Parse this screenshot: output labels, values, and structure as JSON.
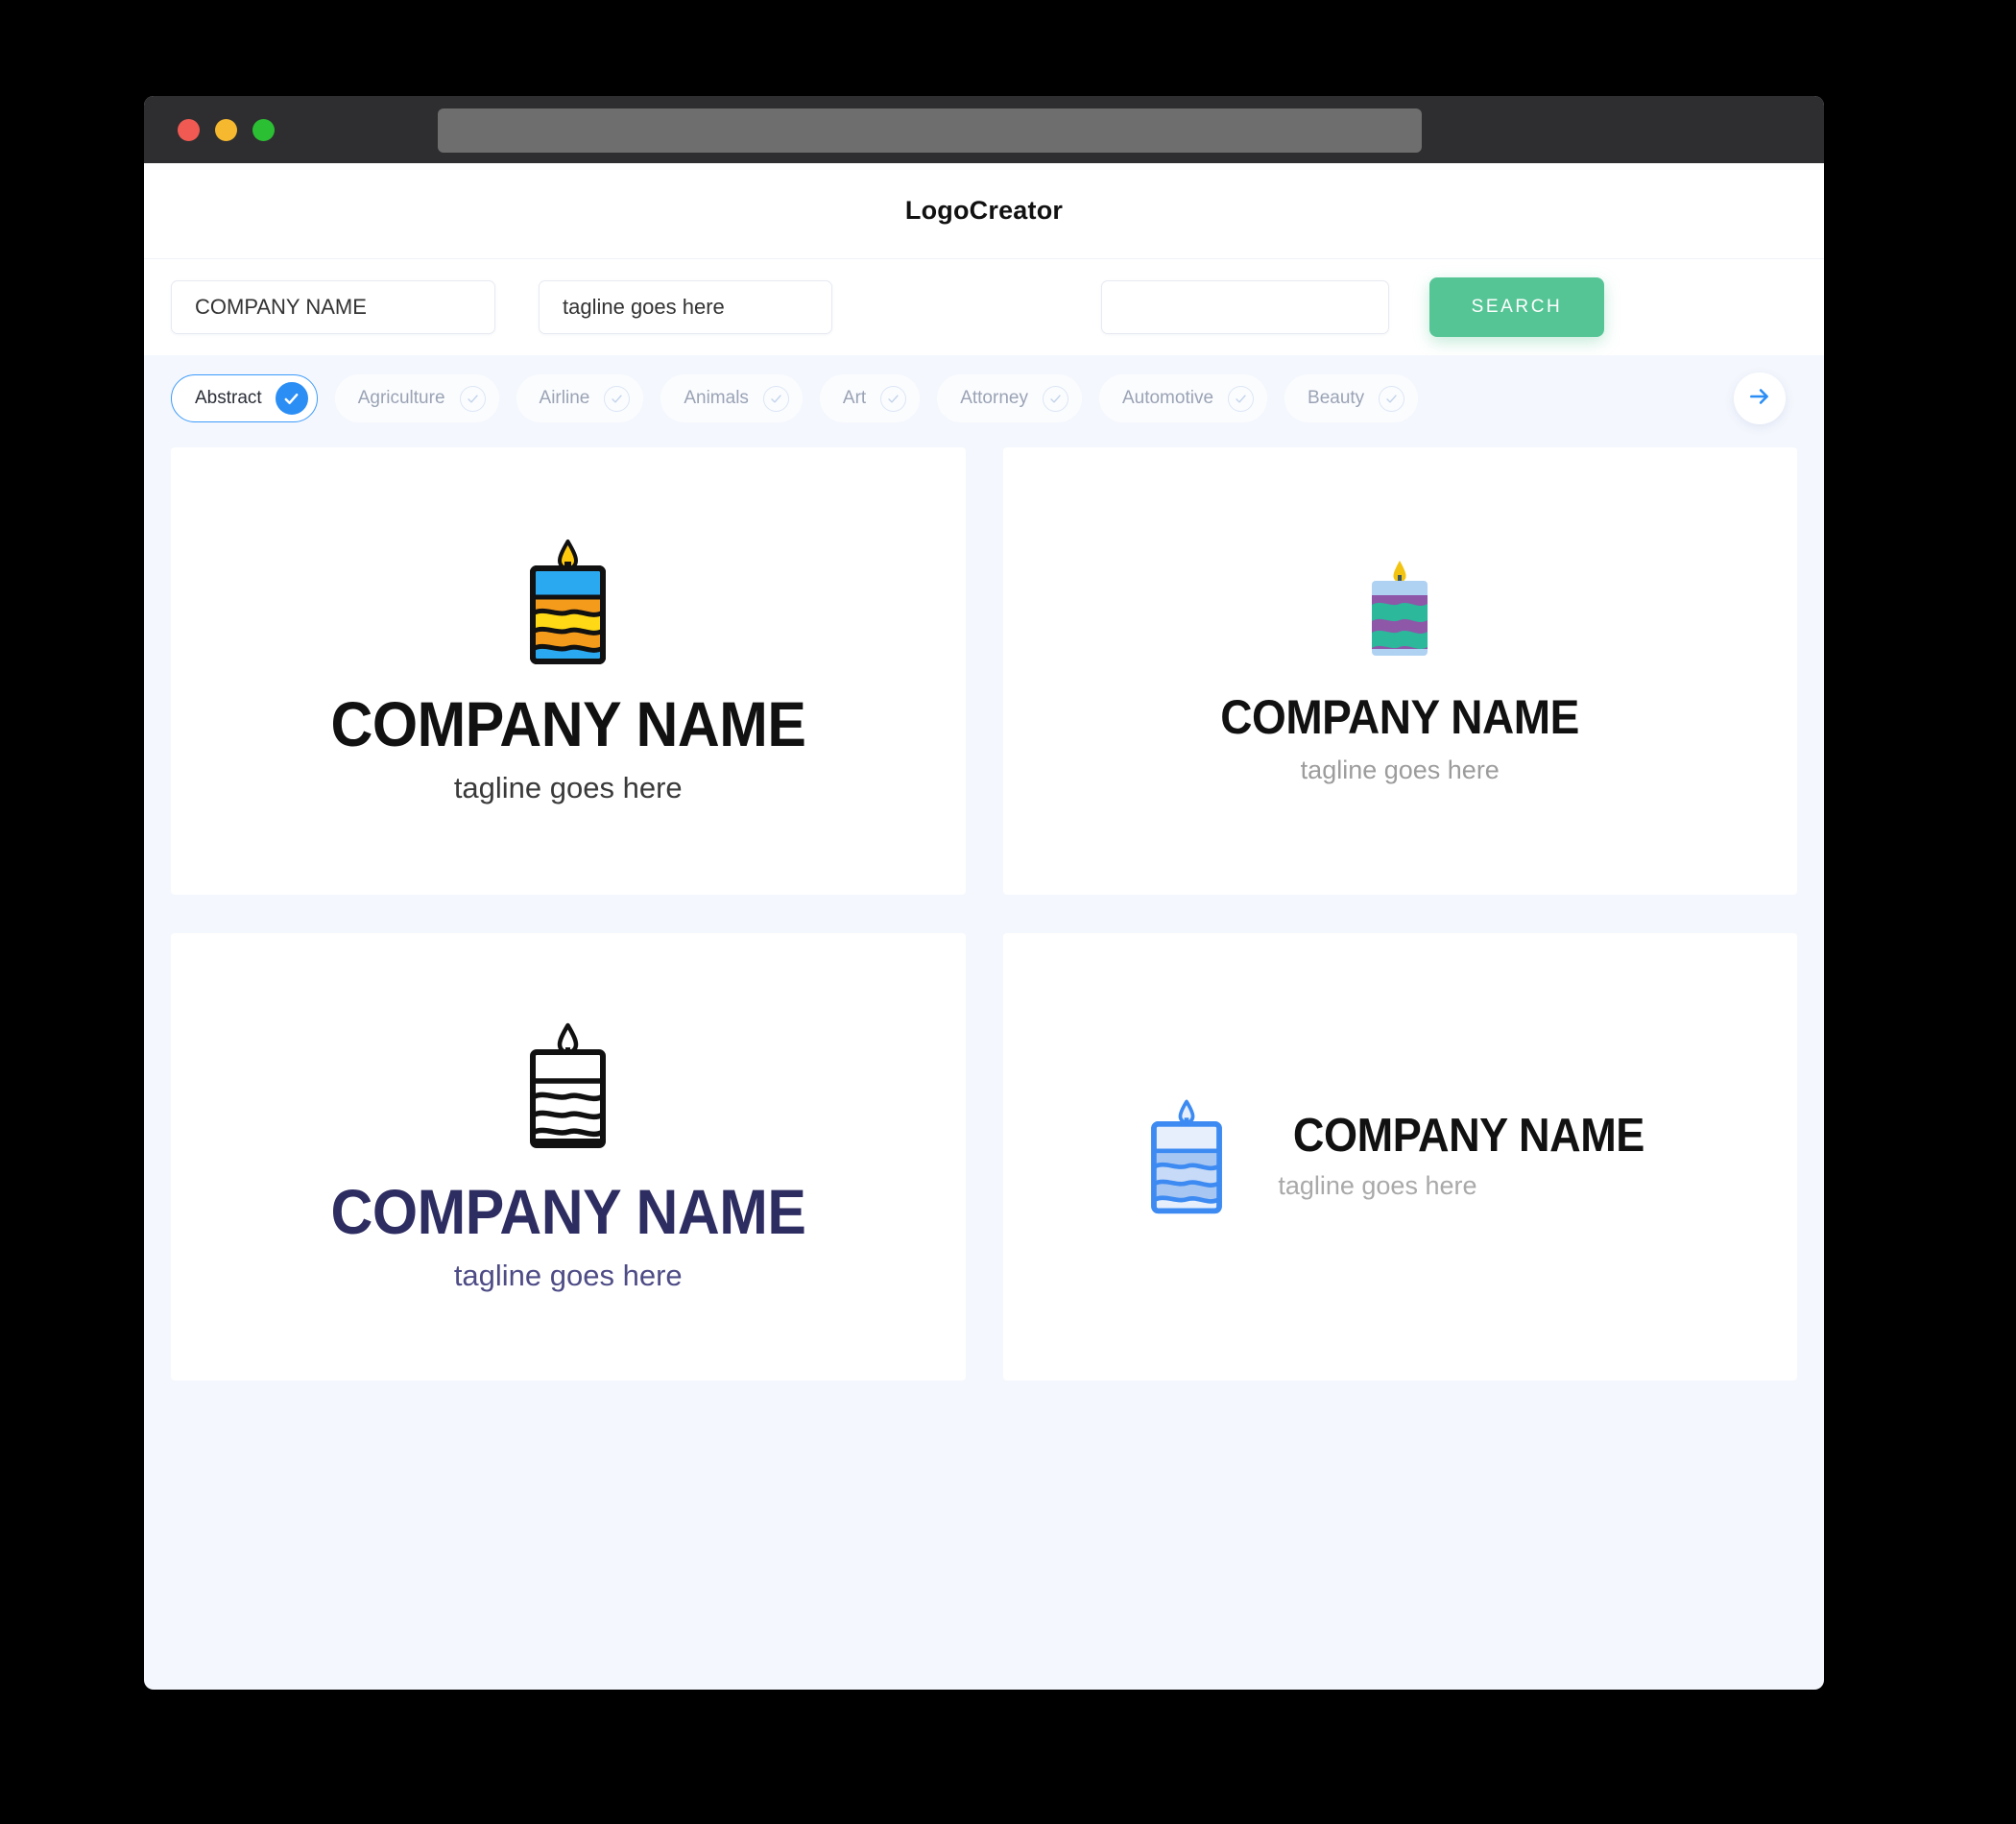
{
  "window": {
    "traffic_lights": [
      "close",
      "minimize",
      "maximize"
    ],
    "url_value": "",
    "colors": {
      "titlebar": "#2E2E30",
      "urlbar": "#6E6E6E",
      "close": "#F05A52",
      "minimize": "#F5B82E",
      "maximize": "#2BBF33",
      "page_bg": "#F4F7FD",
      "accent_green": "#56C596",
      "accent_blue": "#2B8EF5",
      "navy": "#2E2D62"
    }
  },
  "header": {
    "brand": "LogoCreator"
  },
  "search": {
    "company_value": "COMPANY NAME",
    "company_placeholder": "COMPANY NAME",
    "tagline_value": "tagline goes here",
    "tagline_placeholder": "tagline goes here",
    "third_value": "",
    "third_placeholder": "",
    "button_label": "SEARCH"
  },
  "categories": {
    "next_icon": "arrow-right-icon",
    "items": [
      {
        "label": "Abstract",
        "selected": true
      },
      {
        "label": "Agriculture",
        "selected": false
      },
      {
        "label": "Airline",
        "selected": false
      },
      {
        "label": "Animals",
        "selected": false
      },
      {
        "label": "Art",
        "selected": false
      },
      {
        "label": "Attorney",
        "selected": false
      },
      {
        "label": "Automotive",
        "selected": false
      },
      {
        "label": "Beauty",
        "selected": false
      }
    ]
  },
  "results": [
    {
      "id": "logo-1",
      "layout": "vertical",
      "name": "COMPANY NAME",
      "tagline": "tagline goes here",
      "icon": "candle-icon",
      "icon_style": "filled-outline",
      "colors": {
        "top": "#2BA9F0",
        "stripe_a": "#F59B1B",
        "stripe_b": "#FFD816",
        "flame": "#FFC90E",
        "outline": "#111111"
      }
    },
    {
      "id": "logo-2",
      "layout": "vertical",
      "name": "COMPANY NAME",
      "tagline": "tagline goes here",
      "icon": "candle-icon",
      "icon_style": "flat",
      "colors": {
        "top": "#AFD2F2",
        "stripe_a": "#8E57A8",
        "stripe_b": "#2BB89B",
        "flame": "#F2C311",
        "wick": "#3C5563"
      }
    },
    {
      "id": "logo-3",
      "layout": "vertical",
      "name": "COMPANY NAME",
      "tagline": "tagline goes here",
      "icon": "candle-icon",
      "icon_style": "outline",
      "colors": {
        "outline": "#111111",
        "text": "#2E2D62"
      }
    },
    {
      "id": "logo-4",
      "layout": "horizontal",
      "name": "COMPANY NAME",
      "tagline": "tagline goes here",
      "icon": "candle-icon",
      "icon_style": "blue-outline",
      "colors": {
        "outline": "#3D8BF2",
        "fill_light": "#E7EFFC",
        "fill_mid": "#A8C6F2"
      }
    }
  ]
}
